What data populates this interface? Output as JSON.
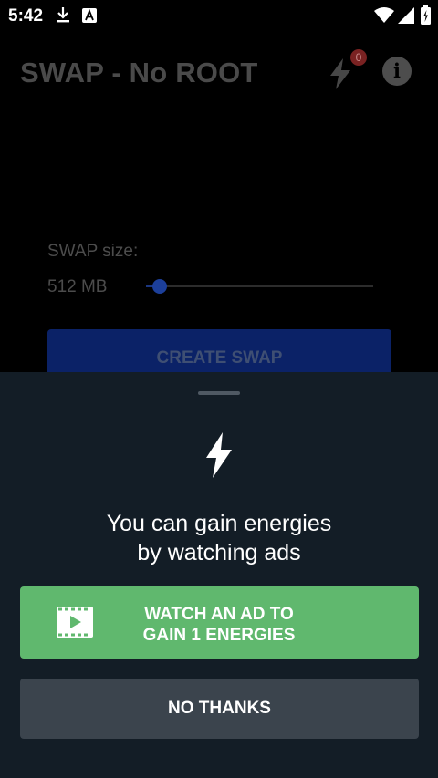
{
  "status_bar": {
    "time": "5:42",
    "icons": [
      "download-icon",
      "font-app-icon",
      "wifi-icon",
      "signal-icon",
      "battery-charging-icon"
    ]
  },
  "app_bar": {
    "title": "SWAP - No ROOT",
    "energy_count": "0",
    "info_icon": "info-icon",
    "info_glyph": "i"
  },
  "main": {
    "swap_label": "SWAP size:",
    "swap_value": "512 MB",
    "slider_fraction": 0.06,
    "create_button": "CREATE SWAP"
  },
  "sheet": {
    "message": "You can gain energies\nby watching ads",
    "watch_button": "WATCH AN AD TO\nGAIN 1 ENERGIES",
    "no_thanks_button": "NO THANKS"
  },
  "colors": {
    "sheet_bg": "#131d26",
    "watch_button_bg": "#60b86e",
    "no_thanks_bg": "#3b444d",
    "create_button_bg": "#0b2267",
    "badge_bg": "#7a2222"
  }
}
